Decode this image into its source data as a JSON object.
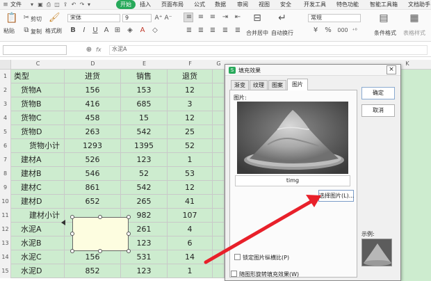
{
  "menubar": {
    "file": "文件",
    "items": [
      "开始",
      "插入",
      "页面布局",
      "公式",
      "数据",
      "审阅",
      "视图",
      "安全",
      "开发工具",
      "特色功能",
      "智能工具箱",
      "文档助手"
    ],
    "active_index": 0
  },
  "ribbon": {
    "cut": "剪切",
    "copy": "复制",
    "paste": "粘贴",
    "format_painter": "格式刷",
    "font": "宋体",
    "size": "9",
    "format": "常规",
    "merge": "合并居中",
    "wrap": "自动换行",
    "cond_format": "条件格式",
    "table_style": "表格样式",
    "currency": "¥",
    "percent": "%",
    "thousands": "000"
  },
  "formula": {
    "fx": "fx",
    "value": "水泥A"
  },
  "columns": [
    "C",
    "D",
    "E",
    "F",
    "G",
    "H",
    "I",
    "J",
    "K"
  ],
  "rows": [
    {
      "n": "1",
      "c": "类型",
      "d": "进货",
      "e": "销售",
      "f": "退货"
    },
    {
      "n": "2",
      "c": "货物A",
      "d": "156",
      "e": "153",
      "f": "12"
    },
    {
      "n": "3",
      "c": "货物B",
      "d": "416",
      "e": "685",
      "f": "3"
    },
    {
      "n": "4",
      "c": "货物C",
      "d": "458",
      "e": "15",
      "f": "12"
    },
    {
      "n": "5",
      "c": "货物D",
      "d": "263",
      "e": "542",
      "f": "25"
    },
    {
      "n": "6",
      "c": "货物小计",
      "d": "1293",
      "e": "1395",
      "f": "52"
    },
    {
      "n": "7",
      "c": "建材A",
      "d": "526",
      "e": "123",
      "f": "1"
    },
    {
      "n": "8",
      "c": "建材B",
      "d": "546",
      "e": "52",
      "f": "53"
    },
    {
      "n": "9",
      "c": "建材C",
      "d": "861",
      "e": "542",
      "f": "12"
    },
    {
      "n": "10",
      "c": "建材D",
      "d": "652",
      "e": "265",
      "f": "41"
    },
    {
      "n": "11",
      "c": "建材小计",
      "d": "",
      "e": "982",
      "f": "107"
    },
    {
      "n": "12",
      "c": "水泥A",
      "d": "",
      "e": "261",
      "f": "4"
    },
    {
      "n": "13",
      "c": "水泥B",
      "d": "",
      "e": "123",
      "f": "6"
    },
    {
      "n": "14",
      "c": "水泥C",
      "d": "156",
      "e": "531",
      "f": "14"
    },
    {
      "n": "15",
      "c": "水泥D",
      "d": "852",
      "e": "123",
      "f": "1"
    }
  ],
  "dialog": {
    "title": "填充效果",
    "tabs": [
      "渐变",
      "纹理",
      "图案",
      "图片"
    ],
    "active_tab": 3,
    "picture_label": "图片:",
    "image_name": "timg",
    "select_button": "选择图片(L)...",
    "ok": "确定",
    "cancel": "取消",
    "sample": "示例:",
    "lock_ratio": "锁定图片纵横比(P)",
    "rotate_fill": "随图形旋转填充效果(W)"
  },
  "colors": {
    "accent": "#27a95a",
    "arrow": "#e8202a",
    "cell_green": "#cdeccf"
  }
}
